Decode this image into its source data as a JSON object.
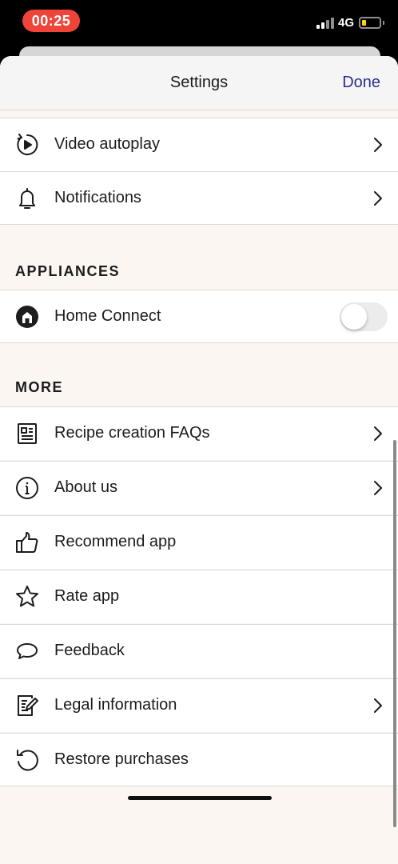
{
  "status_bar": {
    "time": "00:25",
    "network": "4G",
    "battery_level": 0.2
  },
  "nav": {
    "title": "Settings",
    "done_label": "Done"
  },
  "rows_top": [
    {
      "label": "Video autoplay",
      "icon": "video-autoplay-icon",
      "chevron": true
    },
    {
      "label": "Notifications",
      "icon": "bell-icon",
      "chevron": true
    }
  ],
  "appliances": {
    "header": "APPLIANCES",
    "home_connect": {
      "label": "Home Connect",
      "icon": "home-connect-icon",
      "toggle_on": false
    }
  },
  "more": {
    "header": "MORE",
    "items": [
      {
        "label": "Recipe creation FAQs",
        "icon": "document-icon",
        "chevron": true
      },
      {
        "label": "About us",
        "icon": "info-icon",
        "chevron": true
      },
      {
        "label": "Recommend app",
        "icon": "thumbs-up-icon",
        "chevron": false
      },
      {
        "label": "Rate app",
        "icon": "star-icon",
        "chevron": false
      },
      {
        "label": "Feedback",
        "icon": "speech-bubble-icon",
        "chevron": false
      },
      {
        "label": "Legal information",
        "icon": "edit-document-icon",
        "chevron": true
      },
      {
        "label": "Restore purchases",
        "icon": "restore-icon",
        "chevron": false
      }
    ]
  },
  "colors": {
    "accent": "#2b2f8a",
    "section_bg": "#fbf6f2",
    "recording_pill": "#f04438"
  }
}
